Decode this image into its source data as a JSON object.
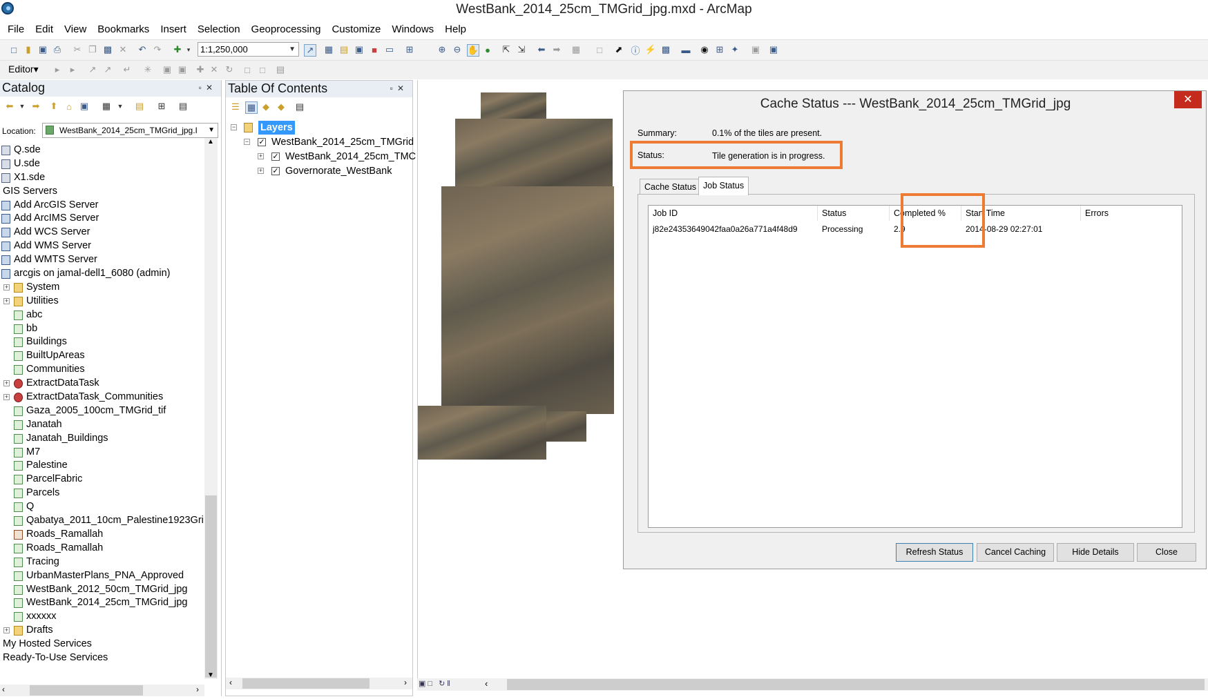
{
  "window": {
    "title": "WestBank_2014_25cm_TMGrid_jpg.mxd - ArcMap"
  },
  "menu": [
    "File",
    "Edit",
    "View",
    "Bookmarks",
    "Insert",
    "Selection",
    "Geoprocessing",
    "Customize",
    "Windows",
    "Help"
  ],
  "toolbar": {
    "scale": "1:1,250,000",
    "editor_label": "Editor▾"
  },
  "catalog": {
    "title": "Catalog",
    "location_label": "Location:",
    "location_value": "WestBank_2014_25cm_TMGrid_jpg.I",
    "items": [
      {
        "label": "Q.sde",
        "icon": "sde-connection-icon",
        "indent": 0,
        "expander": ""
      },
      {
        "label": "U.sde",
        "icon": "sde-connection-icon",
        "indent": 0,
        "expander": ""
      },
      {
        "label": "X1.sde",
        "icon": "sde-connection-icon",
        "indent": 0,
        "expander": ""
      },
      {
        "label": "GIS Servers",
        "icon": "",
        "indent": -1,
        "expander": ""
      },
      {
        "label": "Add ArcGIS Server",
        "icon": "add-server-icon",
        "indent": 0,
        "expander": ""
      },
      {
        "label": "Add ArcIMS Server",
        "icon": "add-server-icon",
        "indent": 0,
        "expander": ""
      },
      {
        "label": "Add WCS Server",
        "icon": "add-server-icon",
        "indent": 0,
        "expander": ""
      },
      {
        "label": "Add WMS Server",
        "icon": "add-server-icon",
        "indent": 0,
        "expander": ""
      },
      {
        "label": "Add WMTS Server",
        "icon": "add-server-icon",
        "indent": 0,
        "expander": ""
      },
      {
        "label": "arcgis on jamal-dell1_6080 (admin)",
        "icon": "server-connection-icon",
        "indent": 0,
        "expander": ""
      },
      {
        "label": "System",
        "icon": "folder-icon",
        "indent": 1,
        "expander": "+"
      },
      {
        "label": "Utilities",
        "icon": "folder-icon",
        "indent": 1,
        "expander": "+"
      },
      {
        "label": "abc",
        "icon": "map-service-icon",
        "indent": 1,
        "expander": ""
      },
      {
        "label": "bb",
        "icon": "map-service-icon",
        "indent": 1,
        "expander": ""
      },
      {
        "label": "Buildings",
        "icon": "map-service-icon",
        "indent": 1,
        "expander": ""
      },
      {
        "label": "BuiltUpAreas",
        "icon": "map-service-icon",
        "indent": 1,
        "expander": ""
      },
      {
        "label": "Communities",
        "icon": "map-service-icon",
        "indent": 1,
        "expander": ""
      },
      {
        "label": "ExtractDataTask",
        "icon": "gp-service-icon",
        "indent": 1,
        "expander": "+"
      },
      {
        "label": "ExtractDataTask_Communities",
        "icon": "gp-service-icon",
        "indent": 1,
        "expander": "+"
      },
      {
        "label": "Gaza_2005_100cm_TMGrid_tif",
        "icon": "map-service-icon",
        "indent": 1,
        "expander": ""
      },
      {
        "label": "Janatah",
        "icon": "map-service-icon",
        "indent": 1,
        "expander": ""
      },
      {
        "label": "Janatah_Buildings",
        "icon": "map-service-icon",
        "indent": 1,
        "expander": ""
      },
      {
        "label": "M7",
        "icon": "map-service-icon",
        "indent": 1,
        "expander": ""
      },
      {
        "label": "Palestine",
        "icon": "map-service-icon",
        "indent": 1,
        "expander": ""
      },
      {
        "label": "ParcelFabric",
        "icon": "map-service-icon",
        "indent": 1,
        "expander": ""
      },
      {
        "label": "Parcels",
        "icon": "map-service-icon",
        "indent": 1,
        "expander": ""
      },
      {
        "label": "Q",
        "icon": "map-service-icon",
        "indent": 1,
        "expander": ""
      },
      {
        "label": "Qabatya_2011_10cm_Palestine1923Gri",
        "icon": "map-service-icon",
        "indent": 1,
        "expander": ""
      },
      {
        "label": "Roads_Ramallah",
        "icon": "feature-service-icon",
        "indent": 1,
        "expander": ""
      },
      {
        "label": "Roads_Ramallah",
        "icon": "map-service-icon",
        "indent": 1,
        "expander": ""
      },
      {
        "label": "Tracing",
        "icon": "map-service-icon",
        "indent": 1,
        "expander": ""
      },
      {
        "label": "UrbanMasterPlans_PNA_Approved",
        "icon": "map-service-icon",
        "indent": 1,
        "expander": ""
      },
      {
        "label": "WestBank_2012_50cm_TMGrid_jpg",
        "icon": "map-service-icon",
        "indent": 1,
        "expander": ""
      },
      {
        "label": "WestBank_2014_25cm_TMGrid_jpg",
        "icon": "map-service-icon",
        "indent": 1,
        "expander": ""
      },
      {
        "label": "xxxxxx",
        "icon": "map-service-icon",
        "indent": 1,
        "expander": ""
      },
      {
        "label": "Drafts",
        "icon": "folder-icon",
        "indent": 1,
        "expander": "+"
      },
      {
        "label": "My Hosted Services",
        "icon": "",
        "indent": -1,
        "expander": ""
      },
      {
        "label": "Ready-To-Use Services",
        "icon": "",
        "indent": -1,
        "expander": ""
      }
    ]
  },
  "toc": {
    "title": "Table Of Contents",
    "layers_label": "Layers",
    "group_layer": "WestBank_2014_25cm_TMGrid",
    "sublayer_1": "WestBank_2014_25cm_TMC",
    "sublayer_2": "Governorate_WestBank"
  },
  "dialog": {
    "title": "Cache Status --- WestBank_2014_25cm_TMGrid_jpg",
    "summary_label": "Summary:",
    "summary_value": "0.1% of the tiles are present.",
    "status_label": "Status:",
    "status_value": "Tile generation is in progress.",
    "tabs": {
      "cache_status": "Cache Status",
      "job_status": "Job Status"
    },
    "columns": [
      "Job ID",
      "Status",
      "Completed %",
      "Start Time",
      "Errors"
    ],
    "job_row": {
      "job_id": "j82e24353649042faa0a26a771a4f48d9",
      "status": "Processing",
      "completed": "2.9",
      "start_time": "2014-08-29 02:27:01",
      "errors": ""
    },
    "buttons": {
      "refresh": "Refresh Status",
      "cancel": "Cancel Caching",
      "hide": "Hide Details",
      "close": "Close"
    },
    "close_glyph": "✕",
    "highlight_color": "#EE7B33"
  }
}
